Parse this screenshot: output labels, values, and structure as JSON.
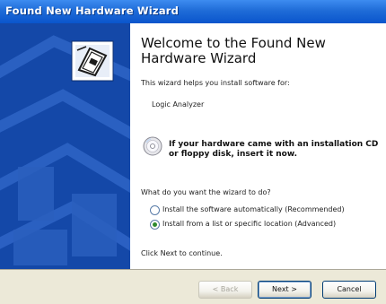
{
  "window": {
    "title": "Found New Hardware Wizard"
  },
  "content": {
    "heading": "Welcome to the Found New Hardware Wizard",
    "intro": "This wizard helps you install software for:",
    "device": "Logic Analyzer",
    "cd_note": "If your hardware came with an installation CD or floppy disk, insert it now.",
    "question": "What do you want the wizard to do?",
    "options": [
      {
        "label": "Install the software automatically (Recommended)",
        "selected": false
      },
      {
        "label": "Install from a list or specific location (Advanced)",
        "selected": true
      }
    ],
    "continue_text": "Click Next to continue."
  },
  "buttons": {
    "back": "< Back",
    "next": "Next >",
    "cancel": "Cancel"
  },
  "icons": {
    "wizard_graphic": "hardware-wizard-icon",
    "cd": "cd-icon"
  },
  "colors": {
    "titlebar": "#0a55cc",
    "sidepanel": "#1448a8",
    "selected_radio": "#2e8a2e"
  }
}
